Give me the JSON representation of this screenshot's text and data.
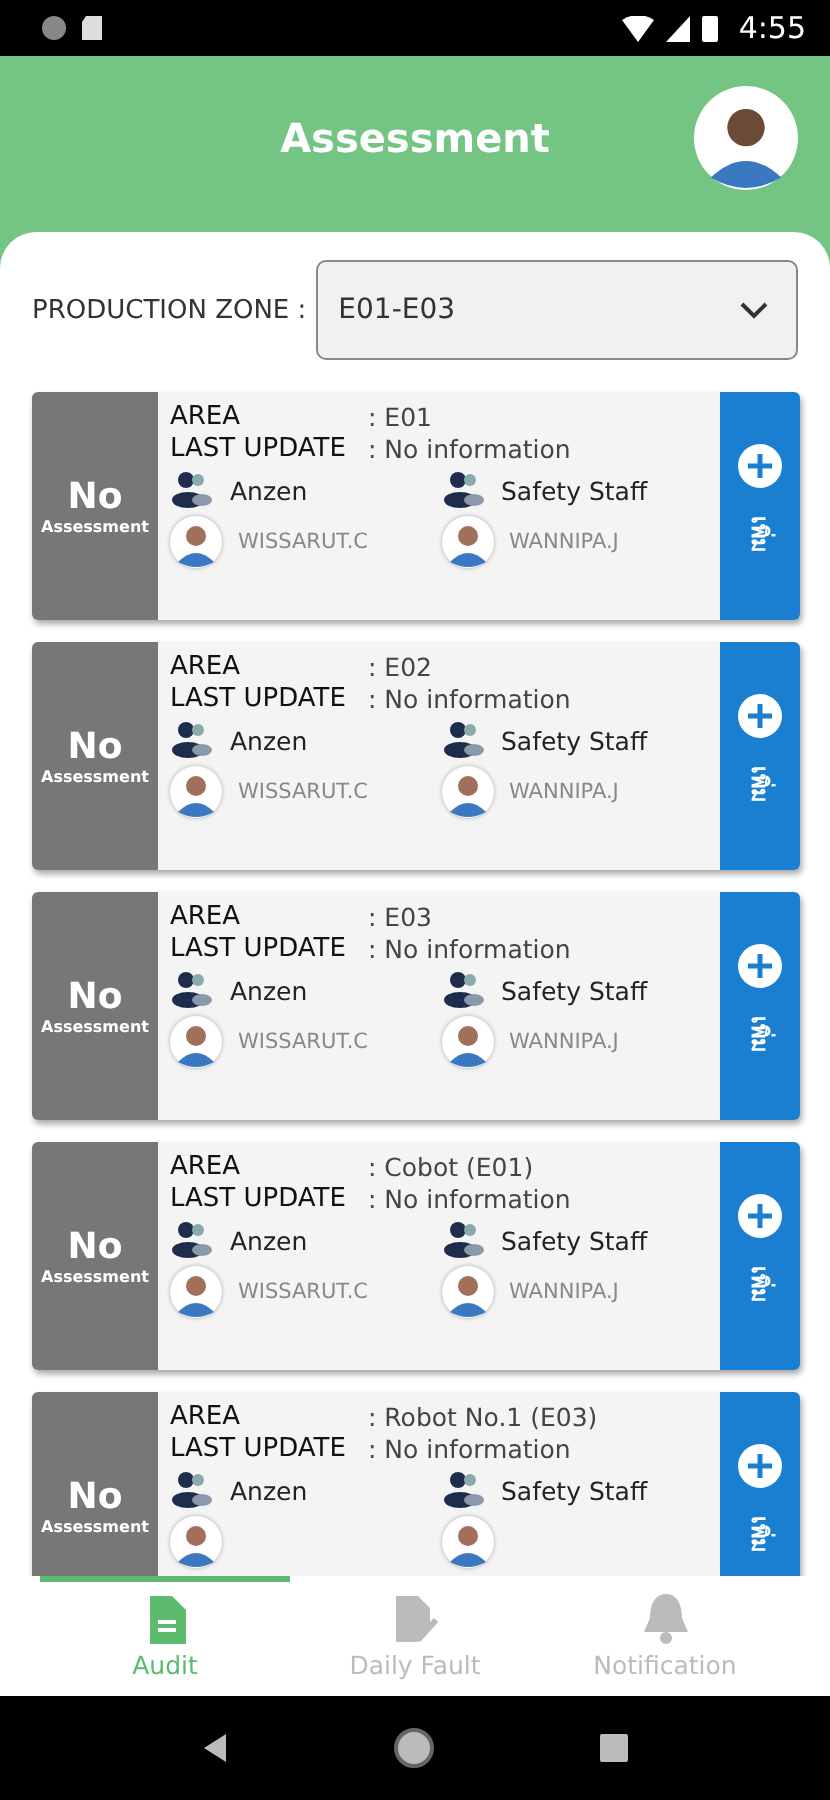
{
  "status_bar": {
    "time": "4:55"
  },
  "header": {
    "title": "Assessment"
  },
  "zone": {
    "label": "PRODUCTION ZONE :",
    "value": "E01-E03"
  },
  "cards": [
    {
      "status": "No",
      "status_sub": "Assessment",
      "area_label": "AREA",
      "area": ": E01",
      "update_label": "LAST UPDATE",
      "update": ": No information",
      "roles": [
        "Anzen",
        "Safety Staff"
      ],
      "people": [
        {
          "name": "WISSARUT.C"
        },
        {
          "name": "WANNIPA.J"
        }
      ],
      "action": "เพิ่ม"
    },
    {
      "status": "No",
      "status_sub": "Assessment",
      "area_label": "AREA",
      "area": ": E02",
      "update_label": "LAST UPDATE",
      "update": ": No information",
      "roles": [
        "Anzen",
        "Safety Staff"
      ],
      "people": [
        {
          "name": "WISSARUT.C"
        },
        {
          "name": "WANNIPA.J"
        }
      ],
      "action": "เพิ่ม"
    },
    {
      "status": "No",
      "status_sub": "Assessment",
      "area_label": "AREA",
      "area": ": E03",
      "update_label": "LAST UPDATE",
      "update": ": No information",
      "roles": [
        "Anzen",
        "Safety Staff"
      ],
      "people": [
        {
          "name": "WISSARUT.C"
        },
        {
          "name": "WANNIPA.J"
        }
      ],
      "action": "เพิ่ม"
    },
    {
      "status": "No",
      "status_sub": "Assessment",
      "area_label": "AREA",
      "area": ": Cobot (E01)",
      "update_label": "LAST UPDATE",
      "update": ": No information",
      "roles": [
        "Anzen",
        "Safety Staff"
      ],
      "people": [
        {
          "name": "WISSARUT.C"
        },
        {
          "name": "WANNIPA.J"
        }
      ],
      "action": "เพิ่ม"
    },
    {
      "status": "No",
      "status_sub": "Assessment",
      "area_label": "AREA",
      "area": ": Robot No.1 (E03)",
      "update_label": "LAST UPDATE",
      "update": ": No information",
      "roles": [
        "Anzen",
        "Safety Staff"
      ],
      "people": [
        {
          "kind": "avatar"
        },
        {
          "kind": "avatar"
        }
      ],
      "action": "เพิ่ม"
    }
  ],
  "tabs": [
    {
      "label": "Audit",
      "kind": "doc",
      "selected": true
    },
    {
      "label": "Daily Fault",
      "kind": "edit",
      "selected": false
    },
    {
      "label": "Notification",
      "kind": "bell",
      "selected": false
    }
  ]
}
